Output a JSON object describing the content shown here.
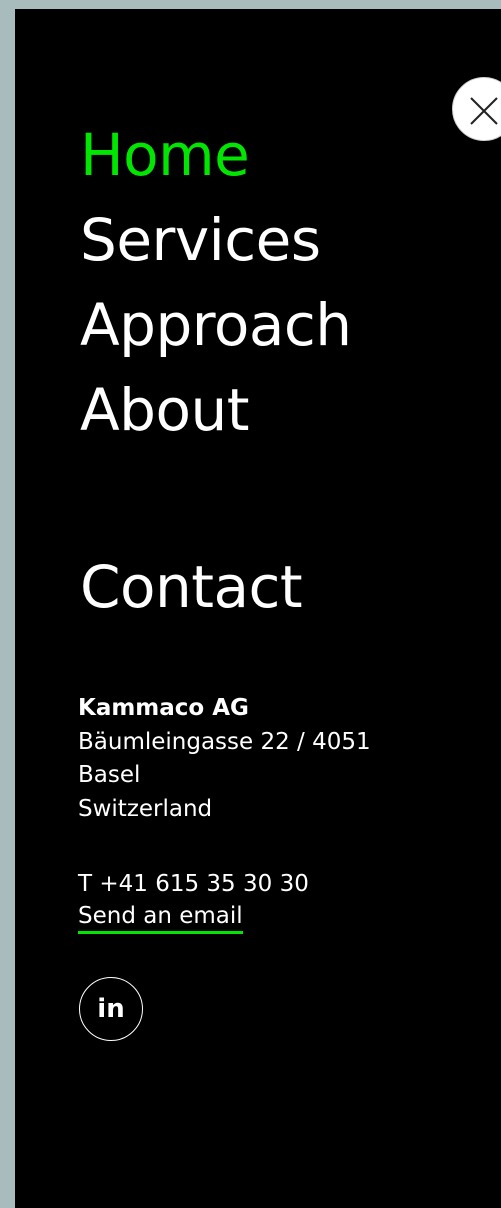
{
  "menu": {
    "items": [
      {
        "label": "Home",
        "active": true
      },
      {
        "label": "Services",
        "active": false
      },
      {
        "label": "Approach",
        "active": false
      },
      {
        "label": "About",
        "active": false
      }
    ],
    "close_icon": "close-icon"
  },
  "contact": {
    "heading": "Contact",
    "company": "Kammaco AG",
    "address_lines": [
      "Bäumleingasse 22 / 4051",
      "Basel",
      "Switzerland"
    ],
    "phone": "T +41 615 35 30 30",
    "email_label": "Send an email",
    "social": {
      "linkedin_label": "in",
      "icon": "linkedin-icon"
    }
  },
  "colors": {
    "background_page": "#a8bcbd",
    "panel": "#000000",
    "accent": "#00e600",
    "text": "#ffffff"
  }
}
